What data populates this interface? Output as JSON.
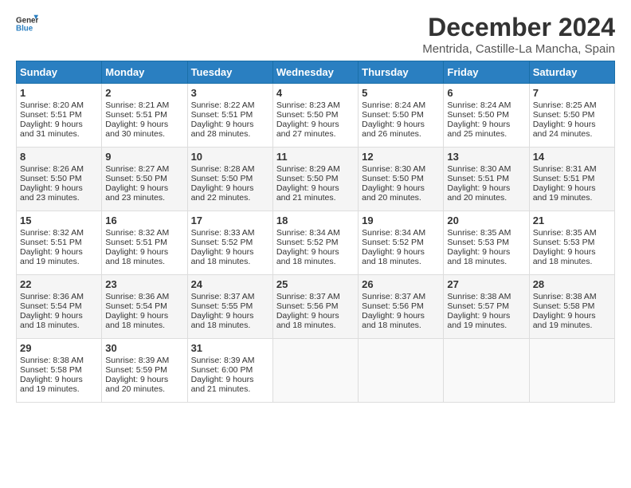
{
  "logo": {
    "general": "General",
    "blue": "Blue"
  },
  "title": "December 2024",
  "subtitle": "Mentrida, Castille-La Mancha, Spain",
  "days_of_week": [
    "Sunday",
    "Monday",
    "Tuesday",
    "Wednesday",
    "Thursday",
    "Friday",
    "Saturday"
  ],
  "weeks": [
    [
      {
        "day": "1",
        "sunrise": "8:20 AM",
        "sunset": "5:51 PM",
        "daylight": "9 hours and 31 minutes."
      },
      {
        "day": "2",
        "sunrise": "8:21 AM",
        "sunset": "5:51 PM",
        "daylight": "9 hours and 30 minutes."
      },
      {
        "day": "3",
        "sunrise": "8:22 AM",
        "sunset": "5:51 PM",
        "daylight": "9 hours and 28 minutes."
      },
      {
        "day": "4",
        "sunrise": "8:23 AM",
        "sunset": "5:50 PM",
        "daylight": "9 hours and 27 minutes."
      },
      {
        "day": "5",
        "sunrise": "8:24 AM",
        "sunset": "5:50 PM",
        "daylight": "9 hours and 26 minutes."
      },
      {
        "day": "6",
        "sunrise": "8:24 AM",
        "sunset": "5:50 PM",
        "daylight": "9 hours and 25 minutes."
      },
      {
        "day": "7",
        "sunrise": "8:25 AM",
        "sunset": "5:50 PM",
        "daylight": "9 hours and 24 minutes."
      }
    ],
    [
      {
        "day": "8",
        "sunrise": "8:26 AM",
        "sunset": "5:50 PM",
        "daylight": "9 hours and 23 minutes."
      },
      {
        "day": "9",
        "sunrise": "8:27 AM",
        "sunset": "5:50 PM",
        "daylight": "9 hours and 23 minutes."
      },
      {
        "day": "10",
        "sunrise": "8:28 AM",
        "sunset": "5:50 PM",
        "daylight": "9 hours and 22 minutes."
      },
      {
        "day": "11",
        "sunrise": "8:29 AM",
        "sunset": "5:50 PM",
        "daylight": "9 hours and 21 minutes."
      },
      {
        "day": "12",
        "sunrise": "8:30 AM",
        "sunset": "5:50 PM",
        "daylight": "9 hours and 20 minutes."
      },
      {
        "day": "13",
        "sunrise": "8:30 AM",
        "sunset": "5:51 PM",
        "daylight": "9 hours and 20 minutes."
      },
      {
        "day": "14",
        "sunrise": "8:31 AM",
        "sunset": "5:51 PM",
        "daylight": "9 hours and 19 minutes."
      }
    ],
    [
      {
        "day": "15",
        "sunrise": "8:32 AM",
        "sunset": "5:51 PM",
        "daylight": "9 hours and 19 minutes."
      },
      {
        "day": "16",
        "sunrise": "8:32 AM",
        "sunset": "5:51 PM",
        "daylight": "9 hours and 18 minutes."
      },
      {
        "day": "17",
        "sunrise": "8:33 AM",
        "sunset": "5:52 PM",
        "daylight": "9 hours and 18 minutes."
      },
      {
        "day": "18",
        "sunrise": "8:34 AM",
        "sunset": "5:52 PM",
        "daylight": "9 hours and 18 minutes."
      },
      {
        "day": "19",
        "sunrise": "8:34 AM",
        "sunset": "5:52 PM",
        "daylight": "9 hours and 18 minutes."
      },
      {
        "day": "20",
        "sunrise": "8:35 AM",
        "sunset": "5:53 PM",
        "daylight": "9 hours and 18 minutes."
      },
      {
        "day": "21",
        "sunrise": "8:35 AM",
        "sunset": "5:53 PM",
        "daylight": "9 hours and 18 minutes."
      }
    ],
    [
      {
        "day": "22",
        "sunrise": "8:36 AM",
        "sunset": "5:54 PM",
        "daylight": "9 hours and 18 minutes."
      },
      {
        "day": "23",
        "sunrise": "8:36 AM",
        "sunset": "5:54 PM",
        "daylight": "9 hours and 18 minutes."
      },
      {
        "day": "24",
        "sunrise": "8:37 AM",
        "sunset": "5:55 PM",
        "daylight": "9 hours and 18 minutes."
      },
      {
        "day": "25",
        "sunrise": "8:37 AM",
        "sunset": "5:56 PM",
        "daylight": "9 hours and 18 minutes."
      },
      {
        "day": "26",
        "sunrise": "8:37 AM",
        "sunset": "5:56 PM",
        "daylight": "9 hours and 18 minutes."
      },
      {
        "day": "27",
        "sunrise": "8:38 AM",
        "sunset": "5:57 PM",
        "daylight": "9 hours and 19 minutes."
      },
      {
        "day": "28",
        "sunrise": "8:38 AM",
        "sunset": "5:58 PM",
        "daylight": "9 hours and 19 minutes."
      }
    ],
    [
      {
        "day": "29",
        "sunrise": "8:38 AM",
        "sunset": "5:58 PM",
        "daylight": "9 hours and 19 minutes."
      },
      {
        "day": "30",
        "sunrise": "8:39 AM",
        "sunset": "5:59 PM",
        "daylight": "9 hours and 20 minutes."
      },
      {
        "day": "31",
        "sunrise": "8:39 AM",
        "sunset": "6:00 PM",
        "daylight": "9 hours and 21 minutes."
      },
      null,
      null,
      null,
      null
    ]
  ]
}
